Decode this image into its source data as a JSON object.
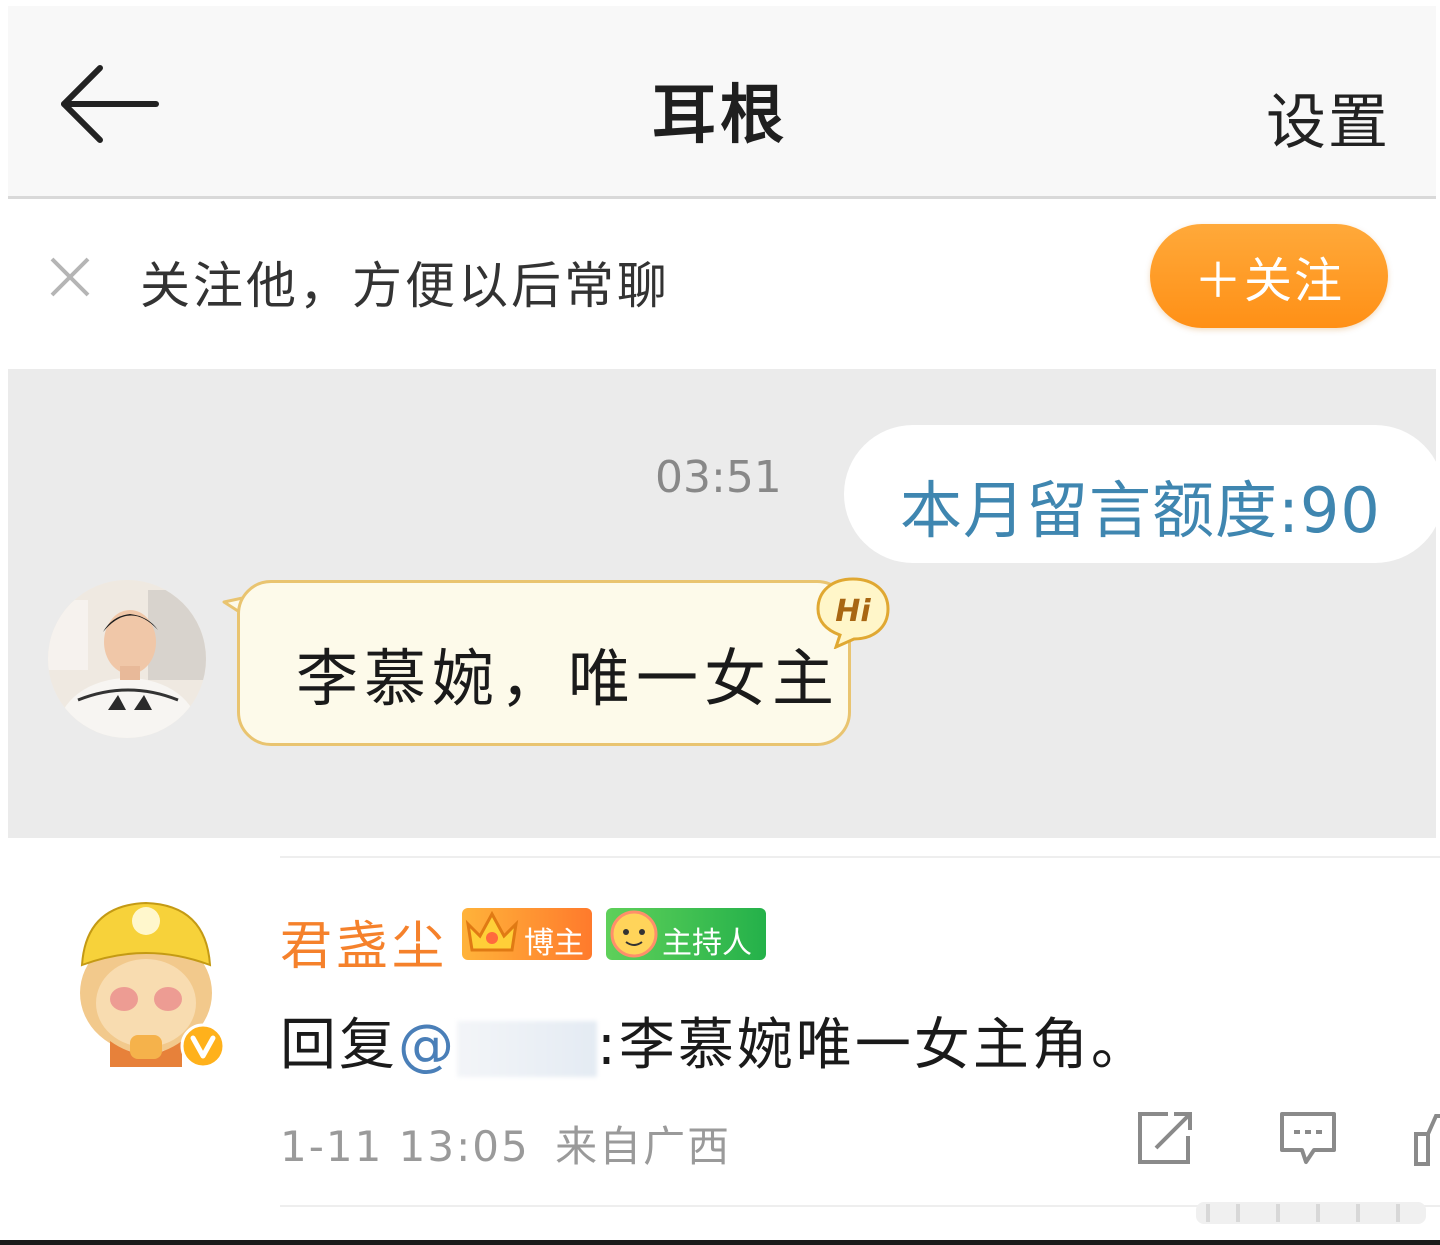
{
  "header": {
    "title": "耳根",
    "settings_label": "设置"
  },
  "follow_bar": {
    "tip": "关注他，方便以后常聊",
    "follow_button": "＋关注"
  },
  "chat": {
    "timestamp": "03:51",
    "system_message": "本月留言额度:90",
    "incoming_message": "李慕婉，唯一女主",
    "hi_badge": "Hi"
  },
  "comment": {
    "author": "君盏尘",
    "badges": [
      "博主",
      "主持人"
    ],
    "reply_prefix": "回复",
    "mention": "@",
    "text": ":李慕婉唯一女主角。",
    "time": "1-11 13:05",
    "location": "来自广西"
  },
  "colors": {
    "accent_orange": "#ff9a20",
    "link_blue": "#3f86b0",
    "name_orange": "#f5812b"
  },
  "icons": [
    "back-arrow-icon",
    "close-icon",
    "hi-badge-icon",
    "verified-icon",
    "share-icon",
    "comment-icon",
    "like-icon"
  ]
}
